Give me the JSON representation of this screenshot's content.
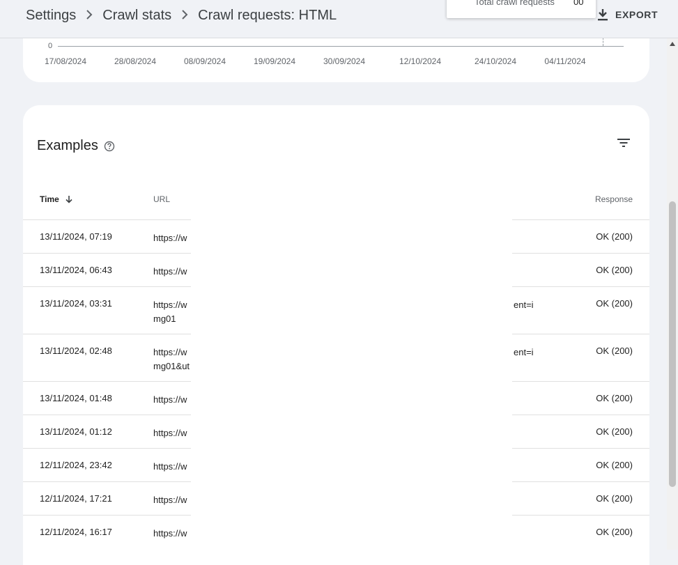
{
  "header": {
    "breadcrumbs": [
      "Settings",
      "Crawl stats",
      "Crawl requests: HTML"
    ],
    "separator": ">",
    "export_label": "EXPORT"
  },
  "tooltip": {
    "label": "Total crawl requests",
    "value": "00"
  },
  "chart": {
    "y_zero": "0",
    "x_ticks": [
      "17/08/2024",
      "28/08/2024",
      "08/09/2024",
      "19/09/2024",
      "30/09/2024",
      "12/10/2024",
      "24/10/2024",
      "04/11/2024"
    ]
  },
  "examples": {
    "title": "Examples",
    "columns": {
      "time": "Time",
      "url": "URL",
      "response": "Response"
    },
    "rows": [
      {
        "time": "13/11/2024, 07:19",
        "url": "https://w",
        "response": "OK (200)"
      },
      {
        "time": "13/11/2024, 06:43",
        "url": "https://w",
        "response": "OK (200)"
      },
      {
        "time": "13/11/2024, 03:31",
        "url": "https://w                                                                                                 ent=i mg01",
        "url_line1_end": "ent=i",
        "url_line2": "mg01",
        "response": "OK (200)"
      },
      {
        "time": "13/11/2024, 02:48",
        "url": "https://w",
        "url_line1_end": "ent=i",
        "url_line2": "mg01&ut",
        "response": "OK (200)"
      },
      {
        "time": "13/11/2024, 01:48",
        "url": "https://w",
        "response": "OK (200)"
      },
      {
        "time": "13/11/2024, 01:12",
        "url": "https://w",
        "response": "OK (200)"
      },
      {
        "time": "12/11/2024, 23:42",
        "url": "https://w",
        "response": "OK (200)"
      },
      {
        "time": "12/11/2024, 17:21",
        "url": "https://w",
        "response": "OK (200)"
      },
      {
        "time": "12/11/2024, 16:17",
        "url": "https://w",
        "response": "OK (200)"
      }
    ]
  }
}
